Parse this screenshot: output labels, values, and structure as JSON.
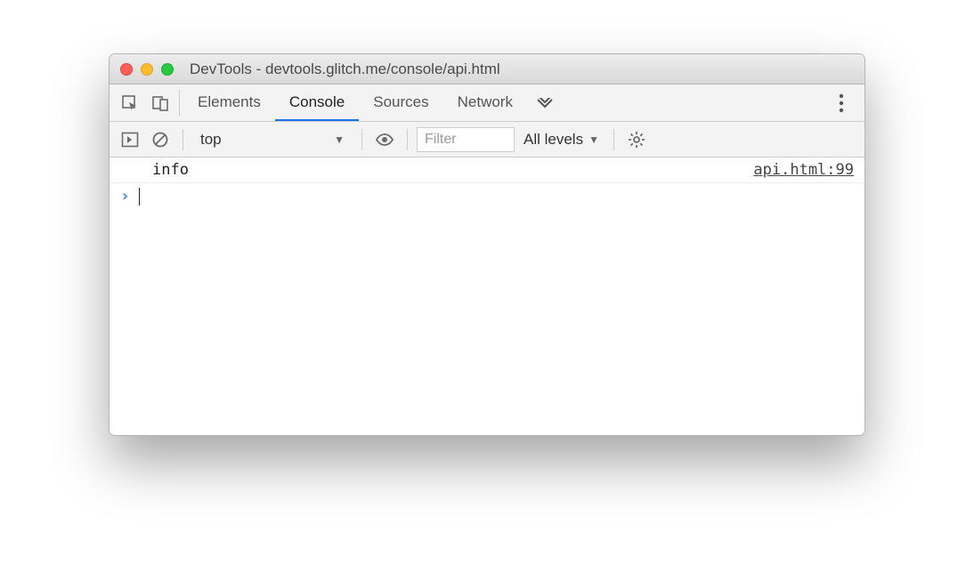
{
  "window": {
    "title": "DevTools - devtools.glitch.me/console/api.html"
  },
  "tabs": {
    "elements": "Elements",
    "console": "Console",
    "sources": "Sources",
    "network": "Network"
  },
  "filterbar": {
    "context": "top",
    "filter_placeholder": "Filter",
    "levels": "All levels"
  },
  "console": {
    "log_message": "info",
    "log_source": "api.html:99"
  }
}
